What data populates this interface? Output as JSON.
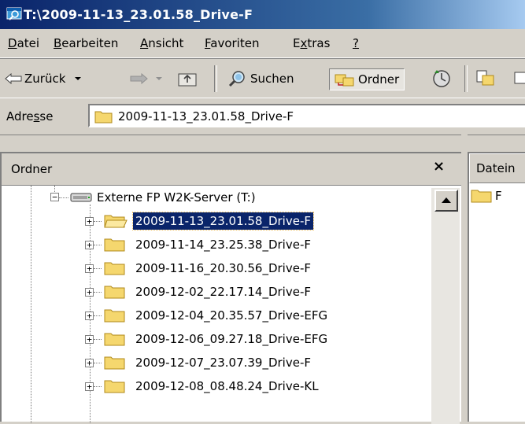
{
  "window": {
    "title": "T:\\2009-11-13_23.01.58_Drive-F"
  },
  "menu": {
    "items": [
      {
        "mnemonic": "D",
        "rest": "atei"
      },
      {
        "mnemonic": "B",
        "rest": "earbeiten"
      },
      {
        "mnemonic": "A",
        "rest": "nsicht"
      },
      {
        "mnemonic": "F",
        "rest": "avoriten"
      },
      {
        "pre": "E",
        "mnemonic": "x",
        "rest": "tras"
      },
      {
        "mnemonic": "?",
        "rest": ""
      }
    ]
  },
  "toolbar": {
    "back_label": "Zurück",
    "search_label": "Suchen",
    "folders_label": "Ordner"
  },
  "address": {
    "label_pre": "Adre",
    "label_mnemonic": "s",
    "label_post": "se",
    "value": "2009-11-13_23.01.58_Drive-F"
  },
  "folder_pane": {
    "title": "Ordner",
    "close_glyph": "×"
  },
  "tree": {
    "drive": "Externe FP W2K-Server (T:)",
    "folders": [
      {
        "name": "2009-11-13_23.01.58_Drive-F",
        "selected": true
      },
      {
        "name": "2009-11-14_23.25.38_Drive-F",
        "selected": false
      },
      {
        "name": "2009-11-16_20.30.56_Drive-F",
        "selected": false
      },
      {
        "name": "2009-12-02_22.17.14_Drive-F",
        "selected": false
      },
      {
        "name": "2009-12-04_20.35.57_Drive-EFG",
        "selected": false
      },
      {
        "name": "2009-12-06_09.27.18_Drive-EFG",
        "selected": false
      },
      {
        "name": "2009-12-07_23.07.39_Drive-F",
        "selected": false
      },
      {
        "name": "2009-12-08_08.48.24_Drive-KL",
        "selected": false
      }
    ]
  },
  "file_pane": {
    "column_header": "Datein",
    "items": [
      {
        "name": "F"
      }
    ]
  },
  "colors": {
    "selection": "#0a246a",
    "folder_fill": "#f5d76e",
    "folder_edge": "#b08a1a"
  }
}
